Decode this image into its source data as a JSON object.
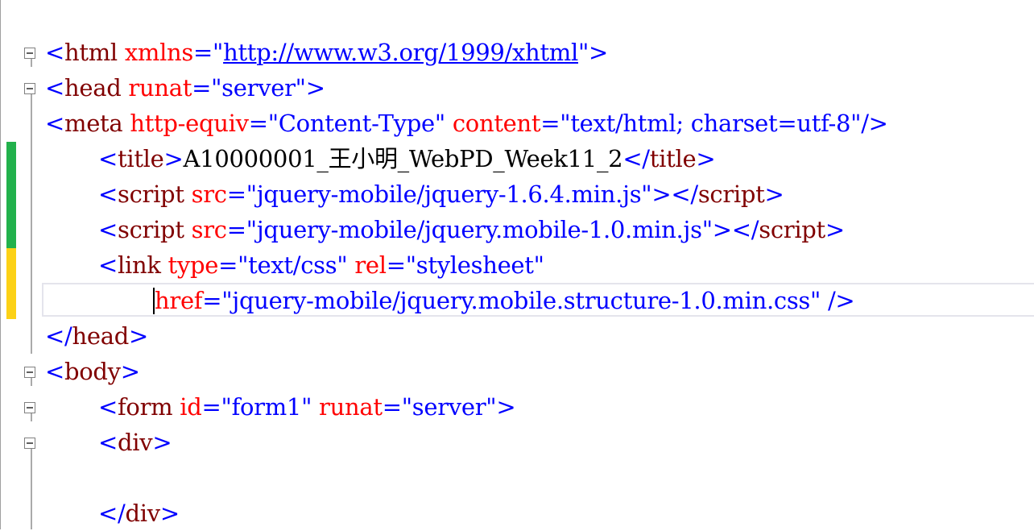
{
  "colors": {
    "bracket": "#0000ff",
    "tag": "#800000",
    "attribute": "#ff0000",
    "value": "#0000ff",
    "text": "#000000",
    "changed_saved": "#22b14c",
    "changed_unsaved": "#fcd116"
  },
  "icons": {
    "fold": "fold-collapse-icon"
  },
  "code": {
    "l1": {
      "lt": "<",
      "tag": "html",
      "sp": " ",
      "attr": "xmlns",
      "eq": "=",
      "q1": "\"",
      "url": "http://www.w3.org/1999/xhtml",
      "q2": "\"",
      "gt": ">"
    },
    "l2": {
      "lt": "<",
      "tag": "head",
      "sp": " ",
      "attr": "runat",
      "eq": "=",
      "val": "\"server\"",
      "gt": ">"
    },
    "l3": {
      "lt": "<",
      "tag": "meta",
      "sp1": " ",
      "attr1": "http-equiv",
      "eq1": "=",
      "val1": "\"Content-Type\"",
      "sp2": " ",
      "attr2": "content",
      "eq2": "=",
      "val2": "\"text/html; charset=utf-8\"",
      "end": "/>"
    },
    "l4": {
      "lt": "<",
      "tag": "title",
      "gt": ">",
      "text": "A10000001_王小明_WebPD_Week11_2",
      "close_lt": "</",
      "close_tag": "title",
      "close_gt": ">"
    },
    "l5": {
      "lt": "<",
      "tag": "script",
      "sp": " ",
      "attr": "src",
      "eq": "=",
      "val": "\"jquery-mobile/jquery-1.6.4.min.js\"",
      "gt": ">",
      "close_lt": "</",
      "close_tag": "script",
      "close_gt": ">"
    },
    "l6": {
      "lt": "<",
      "tag": "script",
      "sp": " ",
      "attr": "src",
      "eq": "=",
      "val": "\"jquery-mobile/jquery.mobile-1.0.min.js\"",
      "gt": ">",
      "close_lt": "</",
      "close_tag": "script",
      "close_gt": ">"
    },
    "l7": {
      "lt": "<",
      "tag": "link",
      "sp1": " ",
      "attr1": "type",
      "eq1": "=",
      "val1": "\"text/css\"",
      "sp2": " ",
      "attr2": "rel",
      "eq2": "=",
      "val2": "\"stylesheet\""
    },
    "l8": {
      "attr": "href",
      "eq": "=",
      "val": "\"jquery-mobile/jquery.mobile.structure-1.0.min.css\"",
      "end": " />"
    },
    "l9": {
      "lt": "</",
      "tag": "head",
      "gt": ">"
    },
    "l10": {
      "lt": "<",
      "tag": "body",
      "gt": ">"
    },
    "l11": {
      "lt": "<",
      "tag": "form",
      "sp1": " ",
      "attr1": "id",
      "eq1": "=",
      "val1": "\"form1\"",
      "sp2": " ",
      "attr2": "runat",
      "eq2": "=",
      "val2": "\"server\"",
      "gt": ">"
    },
    "l12": {
      "lt": "<",
      "tag": "div",
      "gt": ">"
    },
    "l14": {
      "lt": "</",
      "tag": "div",
      "gt": ">"
    }
  }
}
